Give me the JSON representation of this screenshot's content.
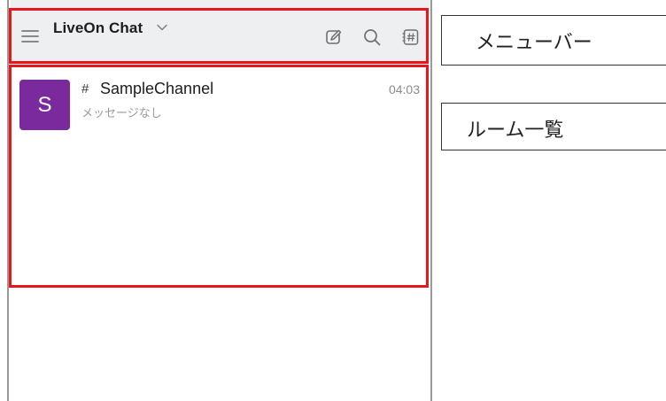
{
  "menu_bar": {
    "app_title": "LiveOn Chat",
    "icons": {
      "menu": "hamburger-menu-icon",
      "dropdown": "chevron-down-icon",
      "compose": "compose-icon",
      "search": "search-icon",
      "channels": "channel-list-icon"
    }
  },
  "room_list": {
    "rooms": [
      {
        "avatar_letter": "S",
        "avatar_color": "#7b2a9d",
        "type_icon": "#",
        "name": "SampleChannel",
        "time": "04:03",
        "preview": "メッセージなし"
      }
    ]
  },
  "annotations": {
    "highlight_color": "#e8161d",
    "labels": {
      "menu_bar": "メニューバー",
      "room_list": "ルーム一覧"
    }
  }
}
